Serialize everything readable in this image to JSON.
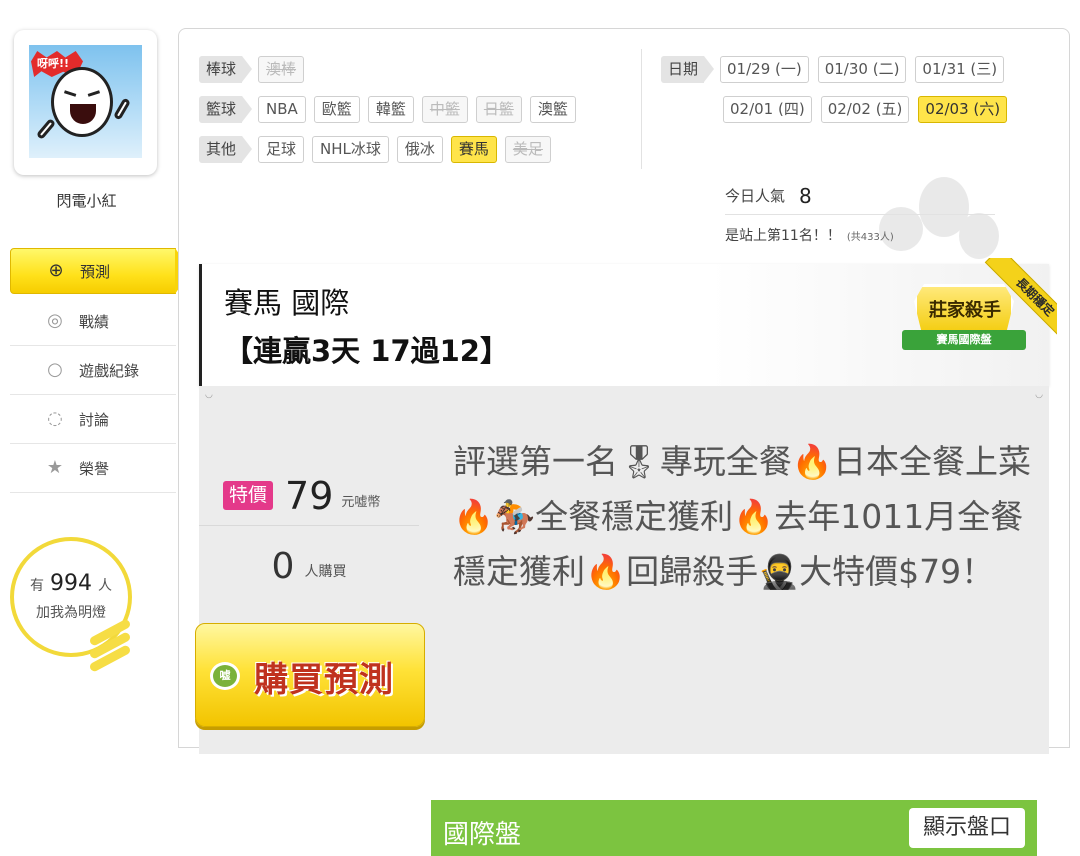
{
  "user": {
    "name": "閃電小紅",
    "avatar_text": "呀呼!!"
  },
  "sidebar": {
    "items": [
      {
        "label": "預測",
        "icon": "crosshair-icon",
        "active": true
      },
      {
        "label": "戰績",
        "icon": "medal-icon"
      },
      {
        "label": "遊戲紀錄",
        "icon": "record-icon"
      },
      {
        "label": "討論",
        "icon": "chat-icon"
      },
      {
        "label": "榮譽",
        "icon": "award-icon"
      }
    ],
    "fans": {
      "prefix": "有",
      "count": "994",
      "suffix": "人",
      "caption": "加我為明燈"
    }
  },
  "filters": {
    "rows": [
      {
        "category": "棒球",
        "chips": [
          {
            "label": "澳棒",
            "state": "disabled"
          }
        ]
      },
      {
        "category": "籃球",
        "chips": [
          {
            "label": "NBA",
            "state": "normal"
          },
          {
            "label": "歐籃",
            "state": "normal"
          },
          {
            "label": "韓籃",
            "state": "normal"
          },
          {
            "label": "中籃",
            "state": "disabled"
          },
          {
            "label": "日籃",
            "state": "disabled"
          },
          {
            "label": "澳籃",
            "state": "normal"
          }
        ]
      },
      {
        "category": "其他",
        "chips": [
          {
            "label": "足球",
            "state": "normal"
          },
          {
            "label": "NHL冰球",
            "state": "normal"
          },
          {
            "label": "俄冰",
            "state": "normal"
          },
          {
            "label": "賽馬",
            "state": "selected"
          },
          {
            "label": "美足",
            "state": "disabled"
          }
        ]
      }
    ]
  },
  "dates": {
    "label": "日期",
    "rows": [
      [
        {
          "label": "01/29 (一)"
        },
        {
          "label": "01/30 (二)"
        },
        {
          "label": "01/31 (三)"
        }
      ],
      [
        {
          "label": "02/01 (四)"
        },
        {
          "label": "02/02 (五)"
        },
        {
          "label": "02/03 (六)",
          "selected": true
        }
      ]
    ]
  },
  "popularity": {
    "today_label": "今日人氣",
    "today_value": "8",
    "rank_text": "是站上第11名！！",
    "total_text": "(共433人)"
  },
  "card": {
    "title": "賽馬 國際",
    "streak": "【連贏3天 17過12】",
    "badge_title": "莊家殺手",
    "badge_sub": "賽馬國際盤",
    "corner_ribbon": "長期穩定",
    "sale_tag": "特價",
    "price": "79",
    "price_unit": "元嘘幣",
    "buyers": "0",
    "buyers_unit": "人購買",
    "buy_button": "購買預測",
    "buy_coin": "嘘",
    "description": "評選第一名🎖專玩全餐🔥日本全餐上菜🔥🏇全餐穩定獲利🔥去年1011月全餐穩定獲利🔥回歸殺手🥷大特價$79！",
    "market_name": "國際盤",
    "show_button": "顯示盤口"
  },
  "colors": {
    "accent_yellow": "#ffe11a",
    "sale_pink": "#e4398a",
    "market_green": "#7cc440",
    "buy_red": "#c0321e"
  }
}
